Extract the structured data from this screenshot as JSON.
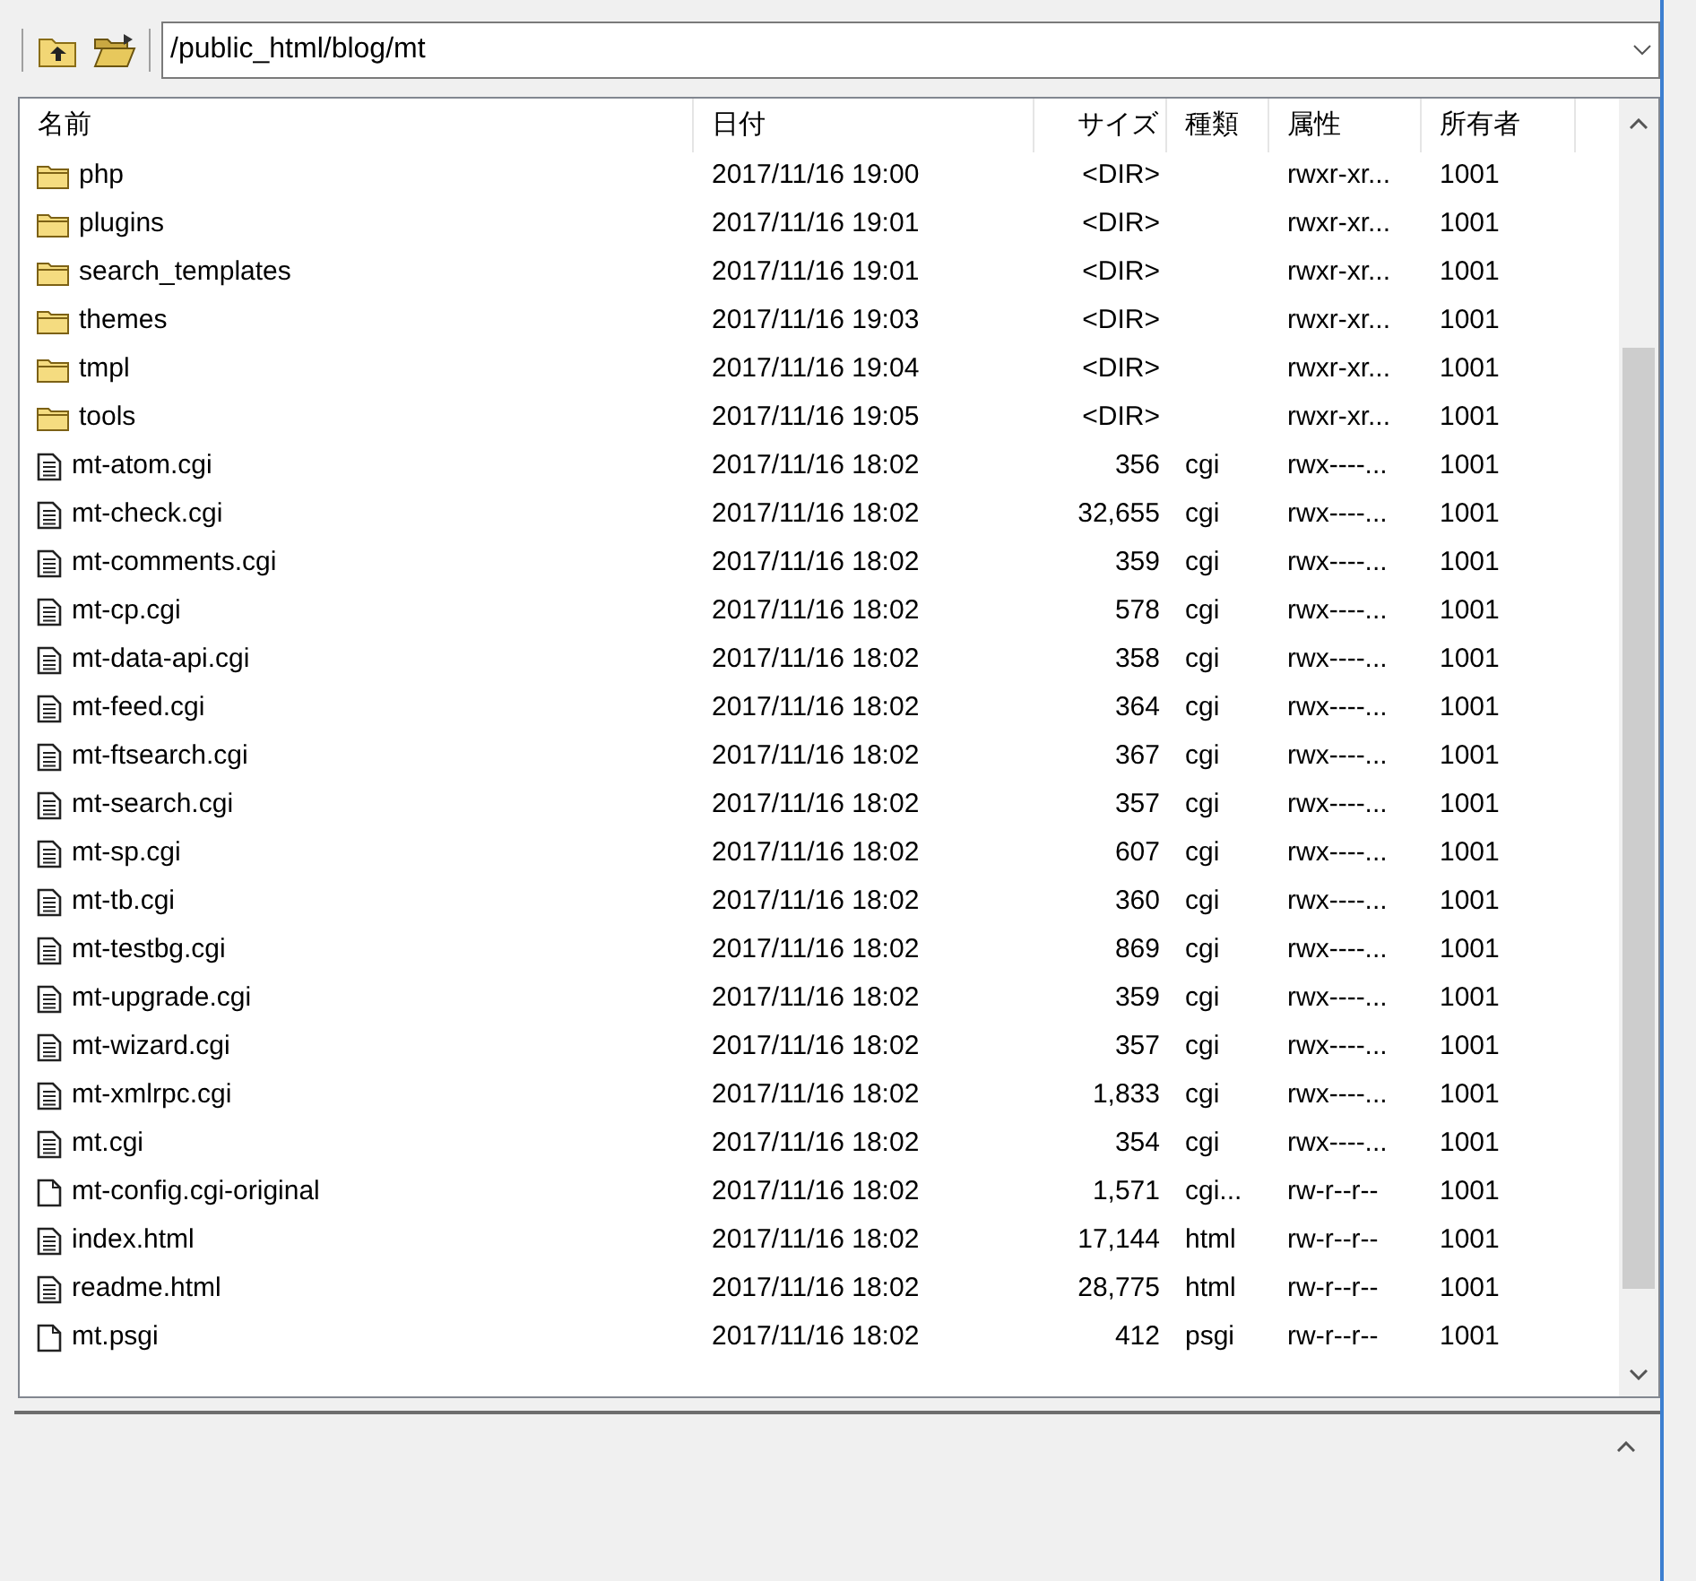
{
  "path_field": {
    "value": "/public_html/blog/mt"
  },
  "columns": [
    "名前",
    "日付",
    "サイズ",
    "種類",
    "属性",
    "所有者"
  ],
  "rows": [
    {
      "kind": "folder",
      "name": "php",
      "date": "2017/11/16 19:00",
      "size": "<DIR>",
      "type": "",
      "attr": "rwxr-xr...",
      "owner": "1001"
    },
    {
      "kind": "folder",
      "name": "plugins",
      "date": "2017/11/16 19:01",
      "size": "<DIR>",
      "attr": "rwxr-xr...",
      "owner": "1001"
    },
    {
      "kind": "folder",
      "name": "search_templates",
      "date": "2017/11/16 19:01",
      "size": "<DIR>",
      "attr": "rwxr-xr...",
      "owner": "1001"
    },
    {
      "kind": "folder",
      "name": "themes",
      "date": "2017/11/16 19:03",
      "size": "<DIR>",
      "attr": "rwxr-xr...",
      "owner": "1001"
    },
    {
      "kind": "folder",
      "name": "tmpl",
      "date": "2017/11/16 19:04",
      "size": "<DIR>",
      "attr": "rwxr-xr...",
      "owner": "1001"
    },
    {
      "kind": "folder",
      "name": "tools",
      "date": "2017/11/16 19:05",
      "size": "<DIR>",
      "attr": "rwxr-xr...",
      "owner": "1001"
    },
    {
      "kind": "text",
      "name": "mt-atom.cgi",
      "date": "2017/11/16 18:02",
      "size": "356",
      "type": "cgi",
      "attr": "rwx----...",
      "owner": "1001"
    },
    {
      "kind": "text",
      "name": "mt-check.cgi",
      "date": "2017/11/16 18:02",
      "size": "32,655",
      "type": "cgi",
      "attr": "rwx----...",
      "owner": "1001"
    },
    {
      "kind": "text",
      "name": "mt-comments.cgi",
      "date": "2017/11/16 18:02",
      "size": "359",
      "type": "cgi",
      "attr": "rwx----...",
      "owner": "1001"
    },
    {
      "kind": "text",
      "name": "mt-cp.cgi",
      "date": "2017/11/16 18:02",
      "size": "578",
      "type": "cgi",
      "attr": "rwx----...",
      "owner": "1001"
    },
    {
      "kind": "text",
      "name": "mt-data-api.cgi",
      "date": "2017/11/16 18:02",
      "size": "358",
      "type": "cgi",
      "attr": "rwx----...",
      "owner": "1001"
    },
    {
      "kind": "text",
      "name": "mt-feed.cgi",
      "date": "2017/11/16 18:02",
      "size": "364",
      "type": "cgi",
      "attr": "rwx----...",
      "owner": "1001"
    },
    {
      "kind": "text",
      "name": "mt-ftsearch.cgi",
      "date": "2017/11/16 18:02",
      "size": "367",
      "type": "cgi",
      "attr": "rwx----...",
      "owner": "1001"
    },
    {
      "kind": "text",
      "name": "mt-search.cgi",
      "date": "2017/11/16 18:02",
      "size": "357",
      "type": "cgi",
      "attr": "rwx----...",
      "owner": "1001"
    },
    {
      "kind": "text",
      "name": "mt-sp.cgi",
      "date": "2017/11/16 18:02",
      "size": "607",
      "type": "cgi",
      "attr": "rwx----...",
      "owner": "1001"
    },
    {
      "kind": "text",
      "name": "mt-tb.cgi",
      "date": "2017/11/16 18:02",
      "size": "360",
      "type": "cgi",
      "attr": "rwx----...",
      "owner": "1001"
    },
    {
      "kind": "text",
      "name": "mt-testbg.cgi",
      "date": "2017/11/16 18:02",
      "size": "869",
      "type": "cgi",
      "attr": "rwx----...",
      "owner": "1001"
    },
    {
      "kind": "text",
      "name": "mt-upgrade.cgi",
      "date": "2017/11/16 18:02",
      "size": "359",
      "type": "cgi",
      "attr": "rwx----...",
      "owner": "1001"
    },
    {
      "kind": "text",
      "name": "mt-wizard.cgi",
      "date": "2017/11/16 18:02",
      "size": "357",
      "type": "cgi",
      "attr": "rwx----...",
      "owner": "1001"
    },
    {
      "kind": "text",
      "name": "mt-xmlrpc.cgi",
      "date": "2017/11/16 18:02",
      "size": "1,833",
      "type": "cgi",
      "attr": "rwx----...",
      "owner": "1001"
    },
    {
      "kind": "text",
      "name": "mt.cgi",
      "date": "2017/11/16 18:02",
      "size": "354",
      "type": "cgi",
      "attr": "rwx----...",
      "owner": "1001"
    },
    {
      "kind": "blank",
      "name": "mt-config.cgi-original",
      "date": "2017/11/16 18:02",
      "size": "1,571",
      "type": "cgi...",
      "attr": "rw-r--r--",
      "owner": "1001"
    },
    {
      "kind": "text",
      "name": "index.html",
      "date": "2017/11/16 18:02",
      "size": "17,144",
      "type": "html",
      "attr": "rw-r--r--",
      "owner": "1001"
    },
    {
      "kind": "text",
      "name": "readme.html",
      "date": "2017/11/16 18:02",
      "size": "28,775",
      "type": "html",
      "attr": "rw-r--r--",
      "owner": "1001"
    },
    {
      "kind": "blank",
      "name": "mt.psgi",
      "date": "2017/11/16 18:02",
      "size": "412",
      "type": "psgi",
      "attr": "rw-r--r--",
      "owner": "1001"
    }
  ]
}
